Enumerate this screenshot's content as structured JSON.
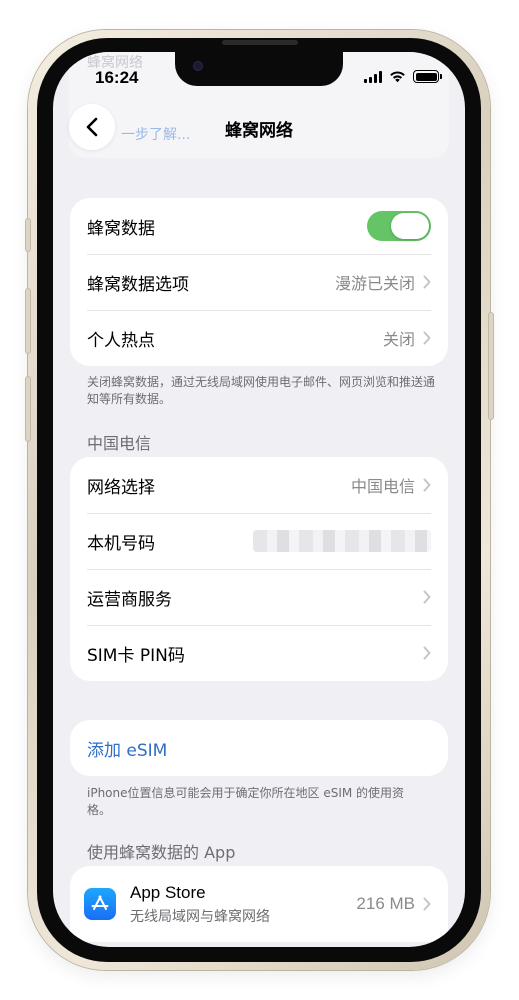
{
  "status_bar": {
    "time": "16:24"
  },
  "background_hint": {
    "top_text": "蜂窝网络",
    "link_text": "一步了解..."
  },
  "nav": {
    "title": "蜂窝网络"
  },
  "cellular_group": {
    "cellular_data_label": "蜂窝数据",
    "cellular_data_on": true,
    "options_label": "蜂窝数据选项",
    "options_value": "漫游已关闭",
    "hotspot_label": "个人热点",
    "hotspot_value": "关闭"
  },
  "cellular_footnote": "关闭蜂窝数据，通过无线局域网使用电子邮件、网页浏览和推送通知等所有数据。",
  "carrier_header": "中国电信",
  "carrier_group": {
    "network_label": "网络选择",
    "network_value": "中国电信",
    "number_label": "本机号码",
    "services_label": "运营商服务",
    "sim_pin_label": "SIM卡 PIN码"
  },
  "esim": {
    "add_label": "添加 eSIM"
  },
  "esim_footnote": "iPhone位置信息可能会用于确定你所在地区 eSIM 的使用资格。",
  "apps_header": "使用蜂窝数据的 App",
  "apps": [
    {
      "name": "App Store",
      "subtitle": "无线局域网与蜂窝网络",
      "usage": "216 MB",
      "icon": "app-store-icon"
    }
  ],
  "colors": {
    "toggle_on": "#65c466",
    "link": "#2f6ec4",
    "background": "#efeff4"
  }
}
